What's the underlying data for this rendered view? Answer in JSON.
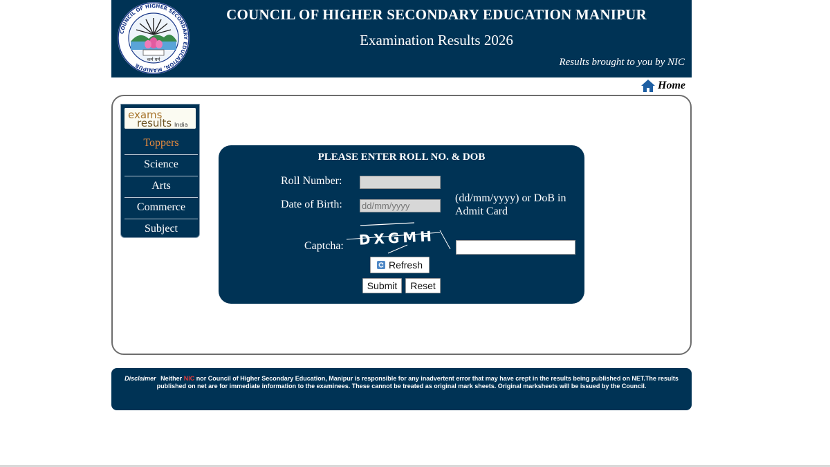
{
  "header": {
    "title": "COUNCIL OF HIGHER SECONDARY EDUCATION MANIPUR",
    "subtitle": "Examination Results 2026",
    "credit": "Results brought to you by NIC",
    "logo_ring_text": "COUNCIL OF HIGHER SECONDARY EDUCATION, MANIPUR",
    "logo_motto": "कर्म धर्म"
  },
  "home": {
    "label": "Home",
    "icon": "home-icon"
  },
  "sidebar": {
    "logo": {
      "line1": "exams",
      "line2": "results",
      "line3": "India"
    },
    "items": [
      {
        "label": "Toppers",
        "active": true
      },
      {
        "label": "Science"
      },
      {
        "label": "Arts"
      },
      {
        "label": "Commerce"
      },
      {
        "label": "Subject"
      }
    ]
  },
  "form": {
    "title": "PLEASE ENTER ROLL NO. & DOB",
    "roll_label": "Roll Number:",
    "roll_value": "",
    "dob_label": "Date of Birth:",
    "dob_placeholder": "dd/mm/yyyy",
    "dob_hint": "(dd/mm/yyyy) or DoB in Admit Card",
    "captcha_label": "Captcha:",
    "captcha_text": "DXGMH",
    "captcha_value": "",
    "refresh_label": "Refresh",
    "submit_label": "Submit",
    "reset_label": "Reset"
  },
  "disclaimer": {
    "label": "Disclaimer",
    "pre": "Neither",
    "nic": "NIC",
    "text": "nor Council of Higher Secondary Education, Manipur is responsible for any inadvertent error that may have crept in the results being published on NET.The results published on net are for immediate information to the examinees. These cannot be treated as original mark sheets. Original marksheets will be issued by the Council."
  },
  "colors": {
    "navy": "#003355",
    "active_nav": "#e98c3d",
    "nic_red": "#e23a3a"
  }
}
